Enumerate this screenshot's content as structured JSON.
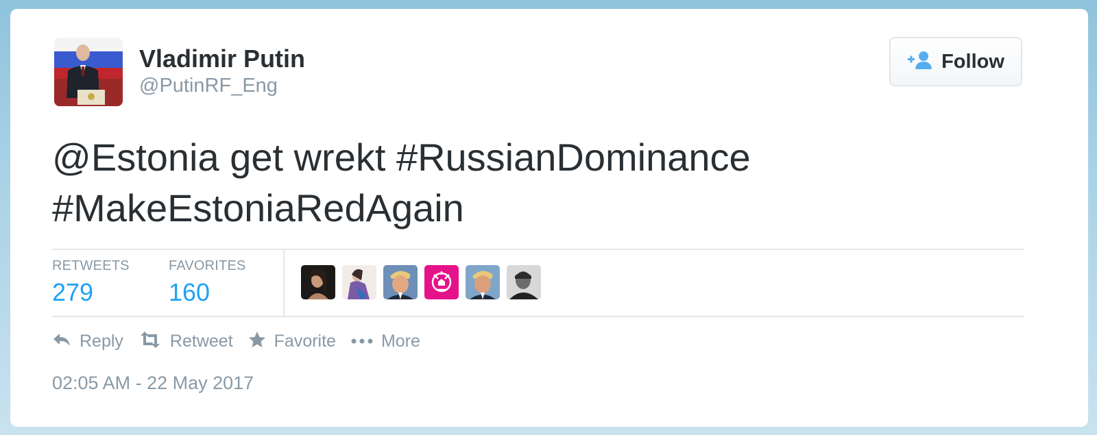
{
  "author": {
    "name": "Vladimir Putin",
    "handle": "@PutinRF_Eng"
  },
  "follow_button": {
    "label": "Follow",
    "icon": "add-user-icon"
  },
  "tweet": {
    "line1": "@Estonia get wrekt #RussianDominance",
    "line2": "#MakeEstoniaRedAgain"
  },
  "stats": {
    "retweets_label": "RETWEETS",
    "retweets_count": "279",
    "favorites_label": "FAVORITES",
    "favorites_count": "160"
  },
  "actions": [
    {
      "label": "Reply",
      "icon": "reply-icon"
    },
    {
      "label": "Retweet",
      "icon": "retweet-icon"
    },
    {
      "label": "Favorite",
      "icon": "star-icon"
    },
    {
      "label": "More",
      "icon": "more-dots-icon"
    }
  ],
  "timestamp": "02:05 AM - 22 May 2017",
  "colors": {
    "text": "#292f33",
    "muted": "#8899a6",
    "accent": "#1da1f2",
    "border": "#e1e8ed",
    "follow_icon": "#55acee"
  }
}
